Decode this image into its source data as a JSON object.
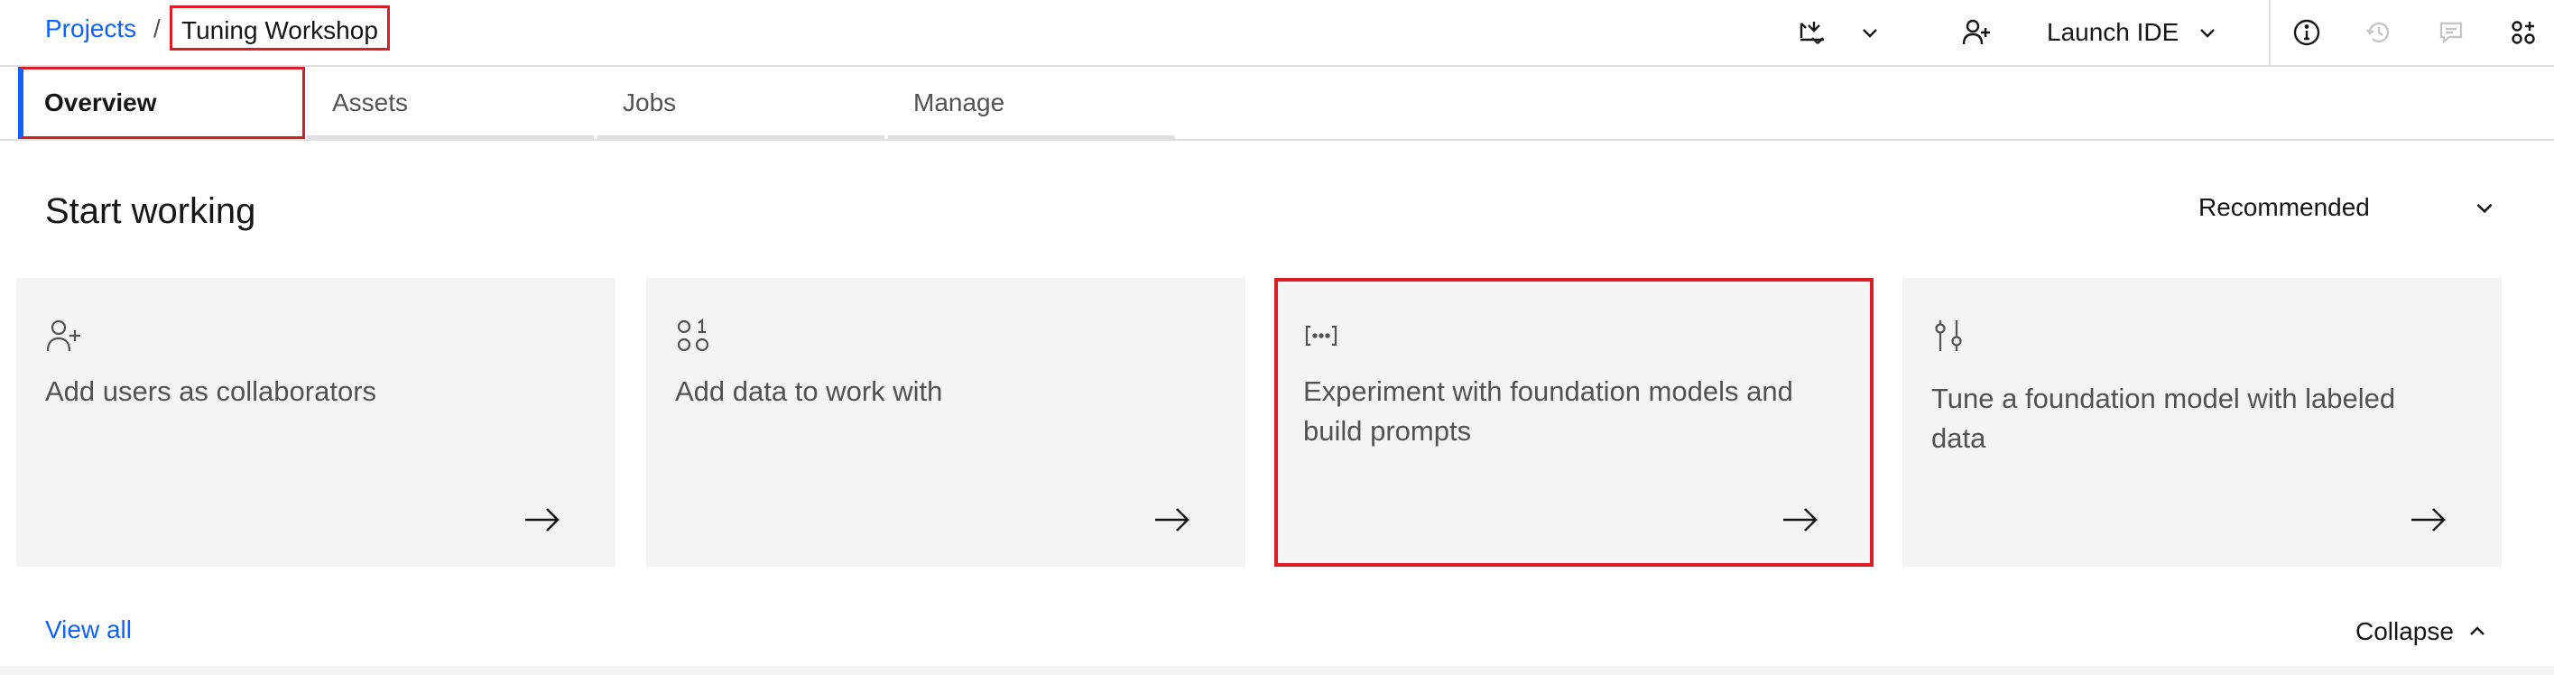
{
  "breadcrumb": {
    "root_label": "Projects",
    "separator": "/",
    "current_label": "Tuning Workshop"
  },
  "header": {
    "launch_ide_label": "Launch IDE",
    "icons": [
      "import-export-icon",
      "chevron-down-icon",
      "add-collaborator-icon",
      "info-icon",
      "history-icon",
      "comment-icon",
      "apps-icon"
    ]
  },
  "tabs": [
    {
      "label": "Overview",
      "active": true
    },
    {
      "label": "Assets",
      "active": false
    },
    {
      "label": "Jobs",
      "active": false
    },
    {
      "label": "Manage",
      "active": false
    }
  ],
  "start_working": {
    "title": "Start working",
    "sort_label": "Recommended",
    "cards": [
      {
        "icon": "user-add-icon",
        "text": "Add users as collaborators"
      },
      {
        "icon": "data-icon",
        "text": "Add data to work with"
      },
      {
        "icon": "prompt-icon",
        "text": "Experiment with foundation models and build prompts"
      },
      {
        "icon": "tune-sliders-icon",
        "text": "Tune a foundation model with labeled data"
      }
    ],
    "view_all_label": "View all",
    "collapse_label": "Collapse"
  },
  "colors": {
    "link": "#0f62fe",
    "highlight_border": "#da1e28",
    "card_bg": "#f4f4f4"
  }
}
